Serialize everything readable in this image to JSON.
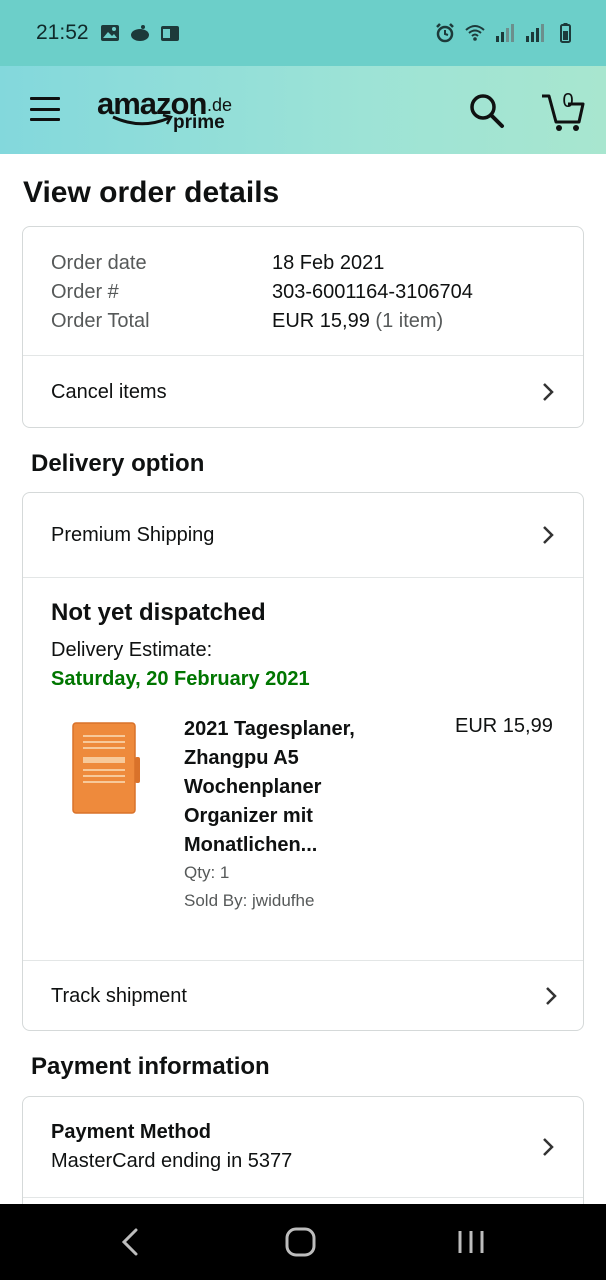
{
  "status_bar": {
    "time": "21:52"
  },
  "header": {
    "logo_amazon": "amazon",
    "logo_de": ".de",
    "logo_prime": "prime",
    "cart_count": "0"
  },
  "page": {
    "title": "View order details"
  },
  "order_summary": {
    "date_label": "Order date",
    "date_value": "18 Feb 2021",
    "number_label": "Order #",
    "number_value": "303-6001164-3106704",
    "total_label": "Order Total",
    "total_value": "EUR 15,99",
    "total_items": "(1 item)",
    "cancel_label": "Cancel items"
  },
  "delivery": {
    "section_title": "Delivery option",
    "shipping_label": "Premium Shipping",
    "status": "Not yet dispatched",
    "estimate_label": "Delivery Estimate:",
    "estimate_date": "Saturday, 20 February 2021",
    "track_label": "Track shipment",
    "product": {
      "title": "2021 Tagesplaner, Zhangpu A5 Wochenplaner Organizer mit Monatlichen...",
      "price": "EUR 15,99",
      "qty": "Qty: 1",
      "seller": "Sold By: jwidufhe"
    }
  },
  "payment": {
    "section_title": "Payment information",
    "method_title": "Payment Method",
    "method_detail": "MasterCard ending in 5377"
  },
  "colors": {
    "status_bar": "#6ccfc9",
    "header_gradient_start": "#83d8dc",
    "header_gradient_end": "#a8e6cf",
    "delivery_green": "#007600"
  },
  "icons": [
    "gallery-icon",
    "cloud-icon",
    "outlook-icon",
    "alarm-icon",
    "wifi-icon",
    "signal-icon",
    "battery-icon",
    "menu-icon",
    "search-icon",
    "cart-icon",
    "chevron-right-icon",
    "back-icon",
    "home-icon",
    "recents-icon"
  ]
}
